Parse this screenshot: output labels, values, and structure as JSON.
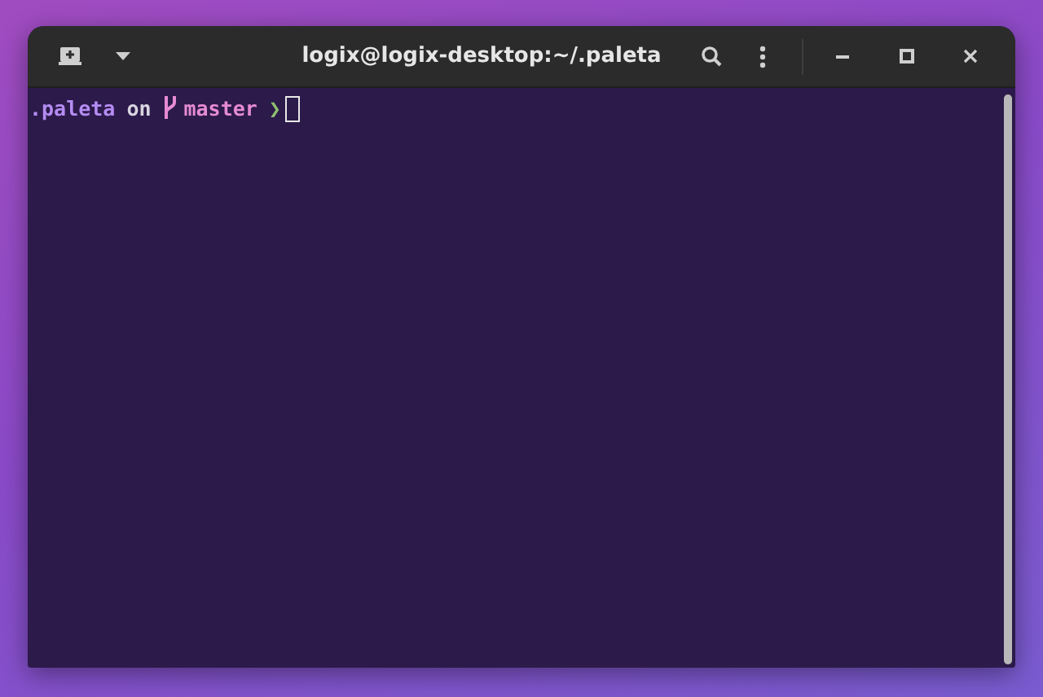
{
  "window": {
    "title": "logix@logix-desktop:~/.paleta"
  },
  "prompt": [
    {
      "kind": "text",
      "text": ".paleta",
      "color": "#b48cf2"
    },
    {
      "kind": "text",
      "text": "on",
      "color": "#d8d4e0"
    },
    {
      "kind": "branch",
      "text": "master",
      "color": "#e58bd3"
    },
    {
      "kind": "text",
      "text": "❯",
      "color": "#8fbf6f"
    }
  ]
}
